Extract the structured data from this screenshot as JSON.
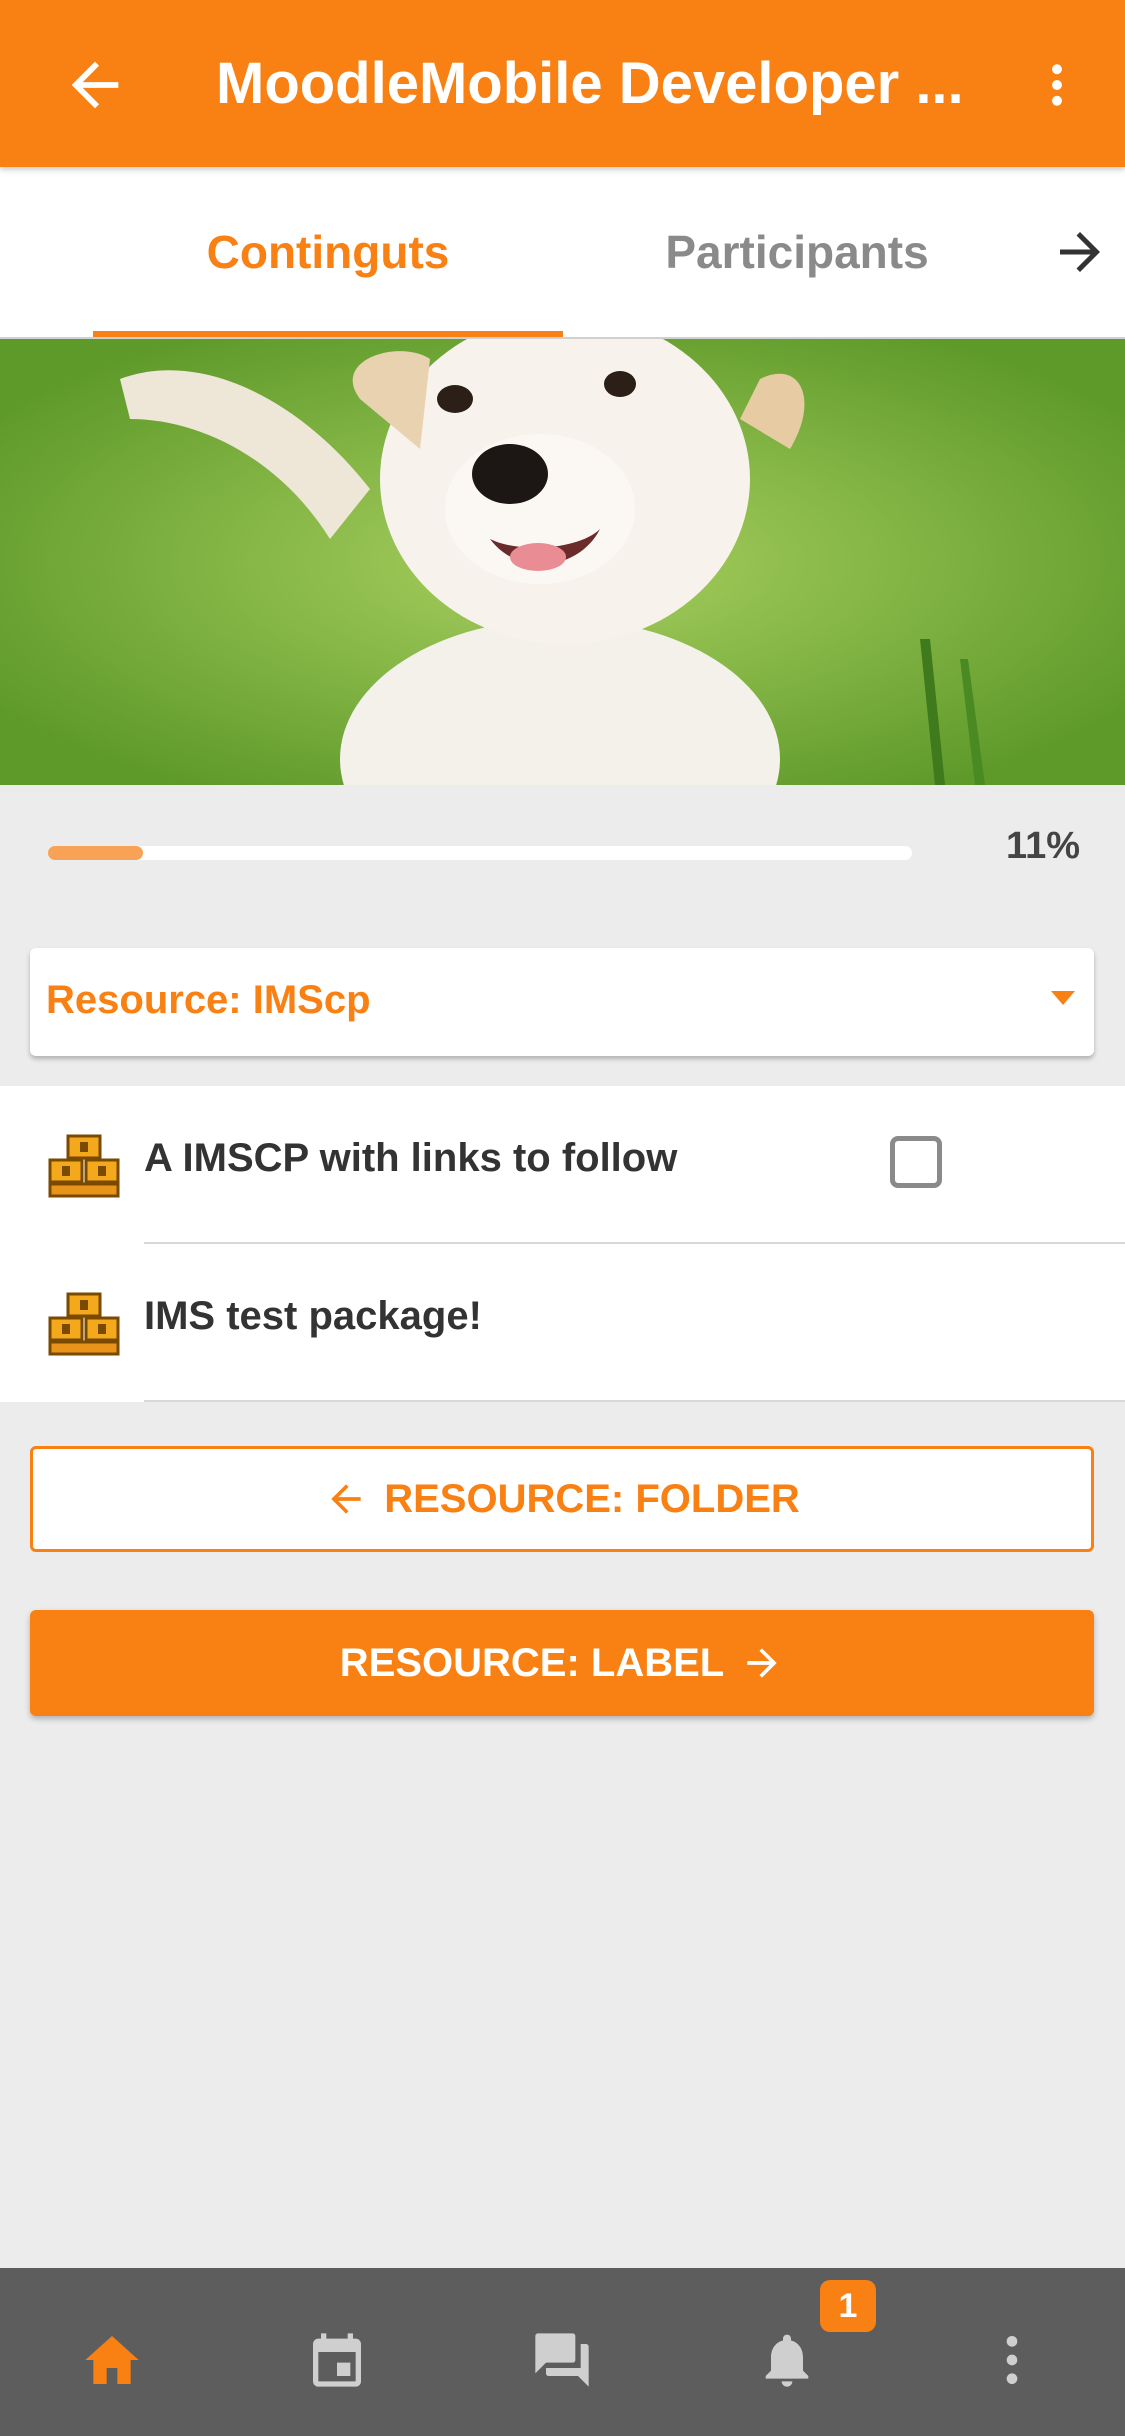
{
  "app": {
    "title": "MoodleMobile Developer ...",
    "accent_color": "#f98012"
  },
  "tabs": [
    {
      "label": "Continguts",
      "active": true
    },
    {
      "label": "Participants",
      "active": false
    }
  ],
  "banner": {
    "image_icon": "puppy-image"
  },
  "progress": {
    "text": "11%",
    "value": 0.11
  },
  "section_selector": {
    "label": "Resource: IMScp"
  },
  "activities": [
    {
      "label": "A IMSCP with links to follow",
      "icon": "imscp-package-icon",
      "has_checkbox": true,
      "checked": false
    },
    {
      "label": "IMS test package!",
      "icon": "imscp-package-icon",
      "has_checkbox": false
    }
  ],
  "navigation": {
    "prev_label": "RESOURCE: FOLDER",
    "next_label": "RESOURCE: LABEL"
  },
  "bottom_nav": {
    "items": [
      "home-icon",
      "calendar-icon",
      "messages-icon",
      "notifications-icon",
      "more-icon"
    ],
    "notification_badge": "1"
  }
}
